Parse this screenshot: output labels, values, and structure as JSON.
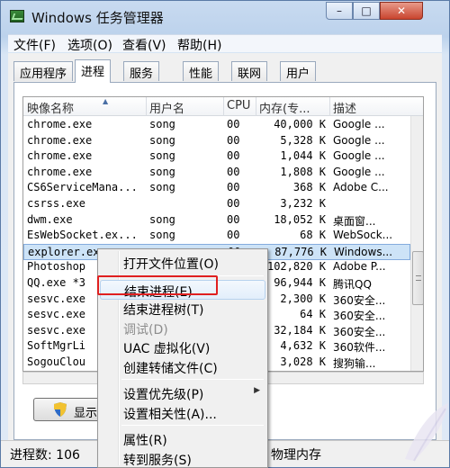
{
  "window": {
    "title": "Windows 任务管理器",
    "controls": {
      "minimize": "–",
      "maximize": "□",
      "close": "✕"
    }
  },
  "menubar": [
    "文件(F)",
    "选项(O)",
    "查看(V)",
    "帮助(H)"
  ],
  "tabs": [
    "应用程序",
    "进程",
    "服务",
    "性能",
    "联网",
    "用户"
  ],
  "active_tab": "进程",
  "columns": [
    "映像名称",
    "用户名",
    "CPU",
    "内存(专...",
    "描述"
  ],
  "rows": [
    [
      "chrome.exe",
      "song",
      "00",
      "40,000 K",
      "Google ..."
    ],
    [
      "chrome.exe",
      "song",
      "00",
      "5,328 K",
      "Google ..."
    ],
    [
      "chrome.exe",
      "song",
      "00",
      "1,044 K",
      "Google ..."
    ],
    [
      "chrome.exe",
      "song",
      "00",
      "1,808 K",
      "Google ..."
    ],
    [
      "CS6ServiceMana...",
      "song",
      "00",
      "368 K",
      "Adobe C..."
    ],
    [
      "csrss.exe",
      "",
      "00",
      "3,232 K",
      ""
    ],
    [
      "dwm.exe",
      "song",
      "00",
      "18,052 K",
      "桌面窗..."
    ],
    [
      "EsWebSocket.ex...",
      "song",
      "00",
      "68 K",
      "WebSock..."
    ],
    [
      "explorer.exe",
      "song",
      "00",
      "87,776 K",
      "Windows..."
    ],
    [
      "Photoshop",
      "",
      "",
      "102,820 K",
      "Adobe P..."
    ],
    [
      "QQ.exe *3",
      "",
      "",
      "96,944 K",
      "腾讯QQ"
    ],
    [
      "sesvc.exe",
      "",
      "",
      "2,300 K",
      "360安全..."
    ],
    [
      "sesvc.exe",
      "",
      "",
      "64 K",
      "360安全..."
    ],
    [
      "sesvc.exe",
      "",
      "",
      "32,184 K",
      "360安全..."
    ],
    [
      "SoftMgrLi",
      "",
      "",
      "4,632 K",
      "360软件..."
    ],
    [
      "SogouClou",
      "",
      "",
      "3,028 K",
      "搜狗输..."
    ]
  ],
  "selected_row": 8,
  "show_button": "显示",
  "status": {
    "processes": "进程数: 106",
    "memory": "物理内存"
  },
  "context_menu": [
    {
      "label": "打开文件位置(O)",
      "disabled": false
    },
    {
      "sep": true
    },
    {
      "label": "结束进程(E)",
      "disabled": false,
      "highlighted": true
    },
    {
      "label": "结束进程树(T)",
      "disabled": false
    },
    {
      "label": "调试(D)",
      "disabled": true
    },
    {
      "label": "UAC 虚拟化(V)",
      "disabled": false
    },
    {
      "label": "创建转储文件(C)",
      "disabled": false
    },
    {
      "sep": true
    },
    {
      "label": "设置优先级(P)",
      "disabled": false,
      "submenu": true
    },
    {
      "label": "设置相关性(A)...",
      "disabled": false
    },
    {
      "sep": true
    },
    {
      "label": "属性(R)",
      "disabled": false
    },
    {
      "label": "转到服务(S)",
      "disabled": false
    }
  ],
  "colors": {
    "highlight_box": "#e02020",
    "selection": "#cde3f7",
    "title_gradient": "#bcd2ec"
  }
}
